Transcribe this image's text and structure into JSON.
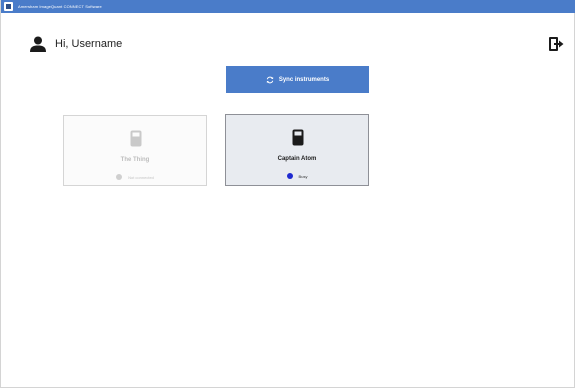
{
  "window": {
    "title": "Amersham ImageQuant CONNECT Software",
    "titlebar_color": "#4a7cc9"
  },
  "header": {
    "greeting": "Hi, Username",
    "user_icon": "user-icon",
    "logout_icon": "logout-icon"
  },
  "sync": {
    "label": "Sync instruments",
    "icon": "sync-icon",
    "color": "#4a7cc9"
  },
  "instruments": [
    {
      "name": "The Thing",
      "status": "Not connected",
      "status_color": "#cfcfcf",
      "icon": "instrument-icon"
    },
    {
      "name": "Captain Atom",
      "status": "Busy",
      "status_color": "#1f2ad0",
      "icon": "instrument-icon"
    }
  ]
}
